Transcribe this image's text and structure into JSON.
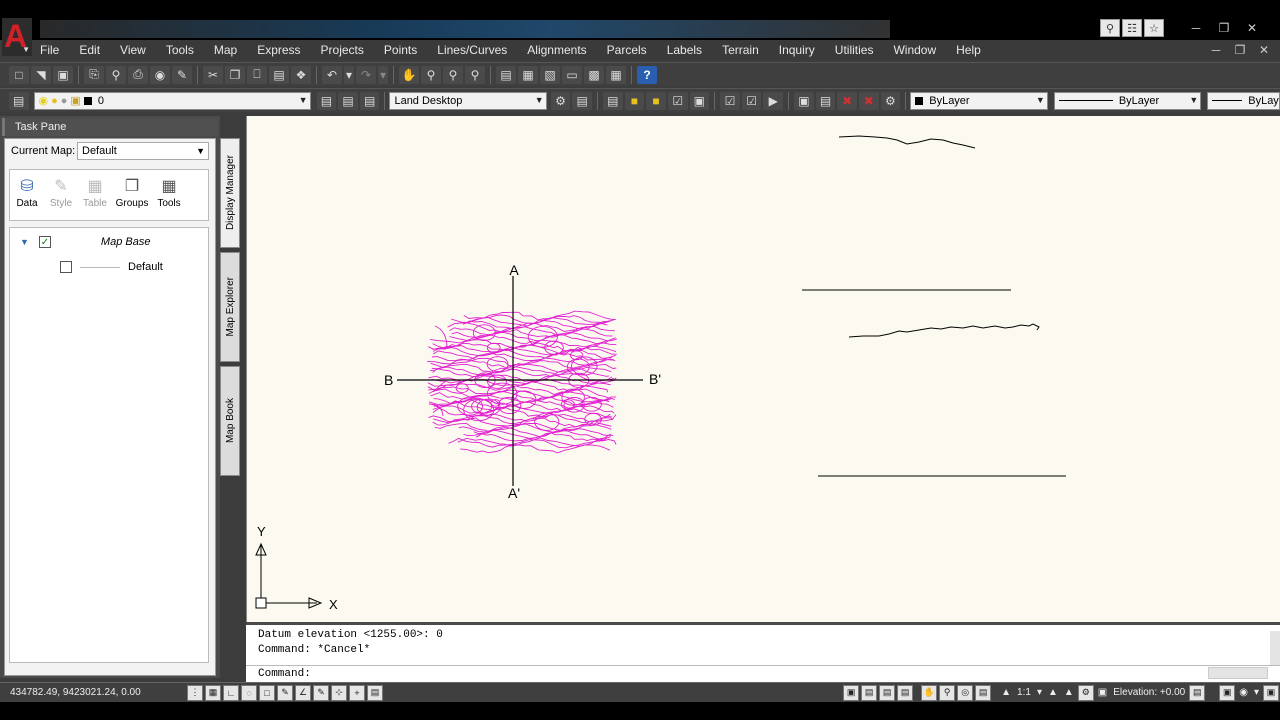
{
  "window": {
    "icons": [
      "search-icon",
      "person-icon",
      "star-icon"
    ],
    "controls": [
      "minimize-icon",
      "restore-icon",
      "close-icon"
    ]
  },
  "menu": {
    "items": [
      "File",
      "Edit",
      "View",
      "Tools",
      "Map",
      "Express",
      "Projects",
      "Points",
      "Lines/Curves",
      "Alignments",
      "Parcels",
      "Labels",
      "Terrain",
      "Inquiry",
      "Utilities",
      "Window",
      "Help"
    ]
  },
  "toolbar": {
    "layer_value": "0",
    "workspace_value": "Land Desktop",
    "color_value": "ByLayer",
    "linetype_value": "ByLayer",
    "lineweight_value": "ByLaye"
  },
  "taskpane": {
    "title": "Task Pane",
    "current_map_label": "Current Map:",
    "current_map_value": "Default",
    "tools": [
      {
        "label": "Data",
        "icon": "database-icon",
        "enabled": true
      },
      {
        "label": "Style",
        "icon": "brush-icon",
        "enabled": false
      },
      {
        "label": "Table",
        "icon": "table-icon",
        "enabled": false
      },
      {
        "label": "Groups",
        "icon": "groups-icon",
        "enabled": true
      },
      {
        "label": "Tools",
        "icon": "tools-icon",
        "enabled": true
      }
    ],
    "tree": {
      "root_label": "Map Base",
      "child_label": "Default"
    },
    "side_tabs": [
      "Display Manager",
      "Map Explorer",
      "Map Book"
    ]
  },
  "drawing": {
    "section_top": "A",
    "section_bottom": "A'",
    "section_left": "B",
    "section_right": "B'",
    "ucs_y": "Y",
    "ucs_x": "X",
    "contour_color": "#e020d0",
    "background": "#fcfaf0"
  },
  "command": {
    "line1": "Datum elevation <1255.00>: 0",
    "line2": "Command: *Cancel*",
    "prompt": "Command:"
  },
  "status": {
    "coords": "434782.49, 9423021.24, 0.00",
    "scale": "1:1",
    "elevation": "Elevation: +0.00"
  }
}
